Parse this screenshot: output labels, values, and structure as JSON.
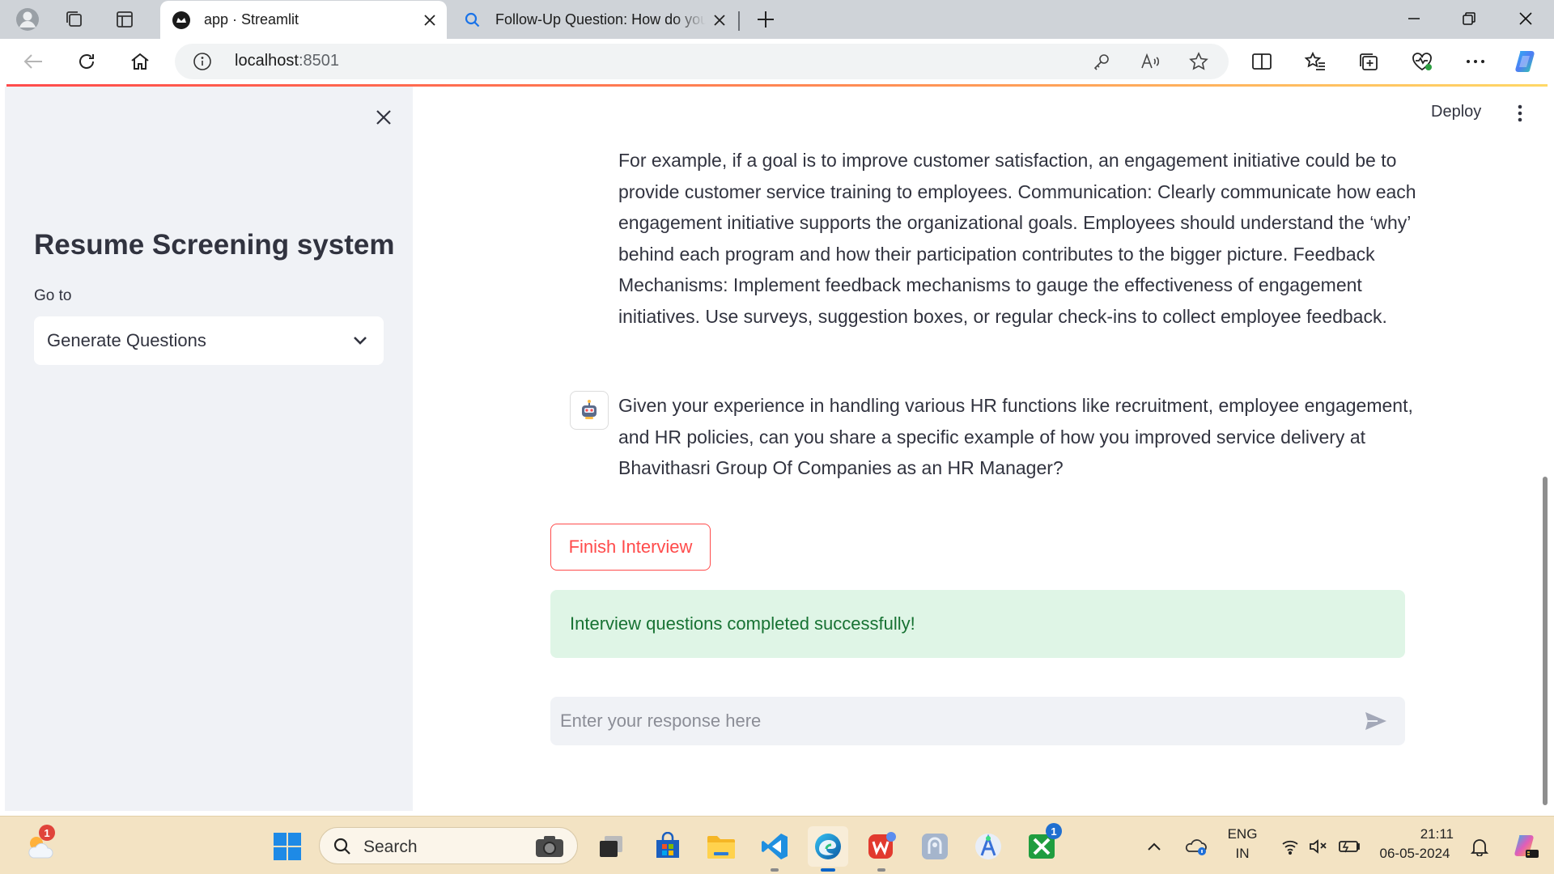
{
  "browser": {
    "tabs": [
      {
        "title": "app · Streamlit",
        "active": true
      },
      {
        "title": "Follow-Up Question: How do you",
        "active": false
      }
    ],
    "url_host": "localhost",
    "url_port": ":8501"
  },
  "app": {
    "header": {
      "deploy_label": "Deploy"
    },
    "sidebar": {
      "title": "Resume Screening system",
      "goto_label": "Go to",
      "select_value": "Generate Questions"
    },
    "messages": [
      {
        "text": "For example, if a goal is to improve customer satisfaction, an engagement initiative could be to provide customer service training to employees. Communication: Clearly communicate how each engagement initiative supports the organizational goals. Employees should understand the ‘why’ behind each program and how their participation contributes to the bigger picture. Feedback Mechanisms: Implement feedback mechanisms to gauge the effectiveness of engagement initiatives. Use surveys, suggestion boxes, or regular check-ins to collect employee feedback."
      },
      {
        "text": "Given your experience in handling various HR functions like recruitment, employee engagement, and HR policies, can you share a specific example of how you improved service delivery at Bhavithasri Group Of Companies as an HR Manager?"
      }
    ],
    "finish_button": "Finish Interview",
    "success_message": "Interview questions completed successfully!",
    "chat_input": {
      "placeholder": "Enter your response here",
      "value": ""
    },
    "colors": {
      "primary": "#ff4b4b",
      "sidebar_bg": "#f0f2f6",
      "success_bg": "#dff5e6",
      "success_text": "#177233"
    }
  },
  "taskbar": {
    "search_placeholder": "Search",
    "weather_badge": "1",
    "xbox_badge": "1",
    "lang_primary": "ENG",
    "lang_secondary": "IN",
    "time": "21:11",
    "date": "06-05-2024"
  }
}
